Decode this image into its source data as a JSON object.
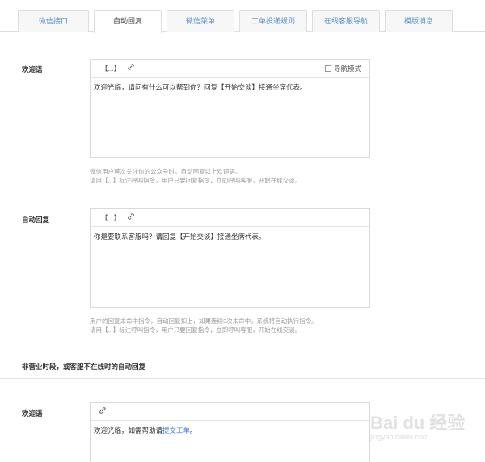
{
  "tabs": [
    {
      "label": "微信接口",
      "active": false
    },
    {
      "label": "自动回复",
      "active": true
    },
    {
      "label": "微信菜单",
      "active": false
    },
    {
      "label": "工单投递规则",
      "active": false
    },
    {
      "label": "在线客服导航",
      "active": false
    },
    {
      "label": "模版消息",
      "active": false
    }
  ],
  "welcome": {
    "label": "欢迎语",
    "toolbar_bracket": "【...】",
    "nav_mode_label": "导航模式",
    "content": "欢迎光临，请问有什么可以帮到你？回复【开始交谈】接通坐席代表。",
    "help_line1": "微信用户首次关注你的公众号时，自动回复以上欢迎语。",
    "help_line2": "请用【...】标注呼叫指令，用户只要回复指令，立即呼叫客服，开始在线交谈。"
  },
  "auto_reply": {
    "label": "自动回复",
    "toolbar_bracket": "【...】",
    "content": "你是要联系客服吗？请回复【开始交谈】接通坐席代表。",
    "help_line1": "用户的回复未命中指令，自动回复如上，如果连续3次未命中，系统将自动执行指令。",
    "help_line2": "请用【...】标注呼叫指令，用户只要回复指令，立即呼叫客服，开始在线交谈。"
  },
  "offhours": {
    "section_title": "非营业时段，或客服不在线时的自动回复",
    "label": "欢迎语",
    "content_prefix": "欢迎光临，如需帮助请",
    "content_link": "提交工单",
    "content_suffix": "。"
  },
  "watermark": {
    "logo": "Bai du 经验",
    "url": "jingyan.baidu.com"
  }
}
